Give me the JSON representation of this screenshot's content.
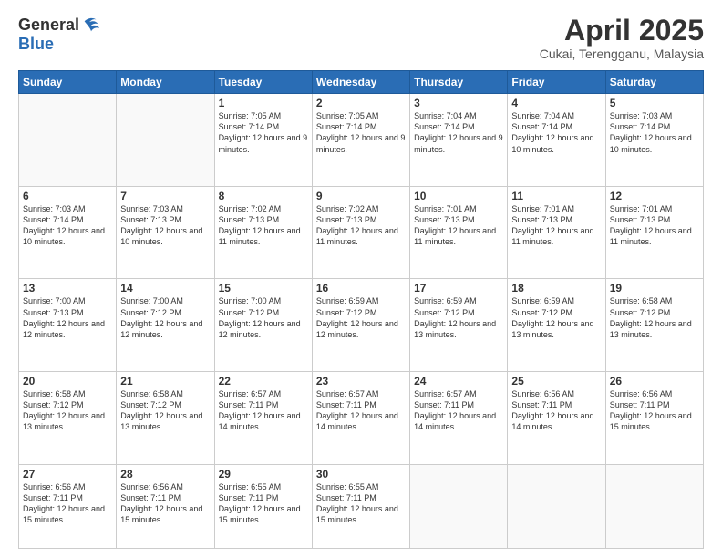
{
  "header": {
    "logo_general": "General",
    "logo_blue": "Blue",
    "month_title": "April 2025",
    "location": "Cukai, Terengganu, Malaysia"
  },
  "weekdays": [
    "Sunday",
    "Monday",
    "Tuesday",
    "Wednesday",
    "Thursday",
    "Friday",
    "Saturday"
  ],
  "days": [
    {
      "num": "",
      "info": ""
    },
    {
      "num": "",
      "info": ""
    },
    {
      "num": "1",
      "info": "Sunrise: 7:05 AM\nSunset: 7:14 PM\nDaylight: 12 hours and 9 minutes."
    },
    {
      "num": "2",
      "info": "Sunrise: 7:05 AM\nSunset: 7:14 PM\nDaylight: 12 hours and 9 minutes."
    },
    {
      "num": "3",
      "info": "Sunrise: 7:04 AM\nSunset: 7:14 PM\nDaylight: 12 hours and 9 minutes."
    },
    {
      "num": "4",
      "info": "Sunrise: 7:04 AM\nSunset: 7:14 PM\nDaylight: 12 hours and 10 minutes."
    },
    {
      "num": "5",
      "info": "Sunrise: 7:03 AM\nSunset: 7:14 PM\nDaylight: 12 hours and 10 minutes."
    },
    {
      "num": "6",
      "info": "Sunrise: 7:03 AM\nSunset: 7:14 PM\nDaylight: 12 hours and 10 minutes."
    },
    {
      "num": "7",
      "info": "Sunrise: 7:03 AM\nSunset: 7:13 PM\nDaylight: 12 hours and 10 minutes."
    },
    {
      "num": "8",
      "info": "Sunrise: 7:02 AM\nSunset: 7:13 PM\nDaylight: 12 hours and 11 minutes."
    },
    {
      "num": "9",
      "info": "Sunrise: 7:02 AM\nSunset: 7:13 PM\nDaylight: 12 hours and 11 minutes."
    },
    {
      "num": "10",
      "info": "Sunrise: 7:01 AM\nSunset: 7:13 PM\nDaylight: 12 hours and 11 minutes."
    },
    {
      "num": "11",
      "info": "Sunrise: 7:01 AM\nSunset: 7:13 PM\nDaylight: 12 hours and 11 minutes."
    },
    {
      "num": "12",
      "info": "Sunrise: 7:01 AM\nSunset: 7:13 PM\nDaylight: 12 hours and 11 minutes."
    },
    {
      "num": "13",
      "info": "Sunrise: 7:00 AM\nSunset: 7:13 PM\nDaylight: 12 hours and 12 minutes."
    },
    {
      "num": "14",
      "info": "Sunrise: 7:00 AM\nSunset: 7:12 PM\nDaylight: 12 hours and 12 minutes."
    },
    {
      "num": "15",
      "info": "Sunrise: 7:00 AM\nSunset: 7:12 PM\nDaylight: 12 hours and 12 minutes."
    },
    {
      "num": "16",
      "info": "Sunrise: 6:59 AM\nSunset: 7:12 PM\nDaylight: 12 hours and 12 minutes."
    },
    {
      "num": "17",
      "info": "Sunrise: 6:59 AM\nSunset: 7:12 PM\nDaylight: 12 hours and 13 minutes."
    },
    {
      "num": "18",
      "info": "Sunrise: 6:59 AM\nSunset: 7:12 PM\nDaylight: 12 hours and 13 minutes."
    },
    {
      "num": "19",
      "info": "Sunrise: 6:58 AM\nSunset: 7:12 PM\nDaylight: 12 hours and 13 minutes."
    },
    {
      "num": "20",
      "info": "Sunrise: 6:58 AM\nSunset: 7:12 PM\nDaylight: 12 hours and 13 minutes."
    },
    {
      "num": "21",
      "info": "Sunrise: 6:58 AM\nSunset: 7:12 PM\nDaylight: 12 hours and 13 minutes."
    },
    {
      "num": "22",
      "info": "Sunrise: 6:57 AM\nSunset: 7:11 PM\nDaylight: 12 hours and 14 minutes."
    },
    {
      "num": "23",
      "info": "Sunrise: 6:57 AM\nSunset: 7:11 PM\nDaylight: 12 hours and 14 minutes."
    },
    {
      "num": "24",
      "info": "Sunrise: 6:57 AM\nSunset: 7:11 PM\nDaylight: 12 hours and 14 minutes."
    },
    {
      "num": "25",
      "info": "Sunrise: 6:56 AM\nSunset: 7:11 PM\nDaylight: 12 hours and 14 minutes."
    },
    {
      "num": "26",
      "info": "Sunrise: 6:56 AM\nSunset: 7:11 PM\nDaylight: 12 hours and 15 minutes."
    },
    {
      "num": "27",
      "info": "Sunrise: 6:56 AM\nSunset: 7:11 PM\nDaylight: 12 hours and 15 minutes."
    },
    {
      "num": "28",
      "info": "Sunrise: 6:56 AM\nSunset: 7:11 PM\nDaylight: 12 hours and 15 minutes."
    },
    {
      "num": "29",
      "info": "Sunrise: 6:55 AM\nSunset: 7:11 PM\nDaylight: 12 hours and 15 minutes."
    },
    {
      "num": "30",
      "info": "Sunrise: 6:55 AM\nSunset: 7:11 PM\nDaylight: 12 hours and 15 minutes."
    },
    {
      "num": "",
      "info": ""
    },
    {
      "num": "",
      "info": ""
    },
    {
      "num": "",
      "info": ""
    }
  ]
}
